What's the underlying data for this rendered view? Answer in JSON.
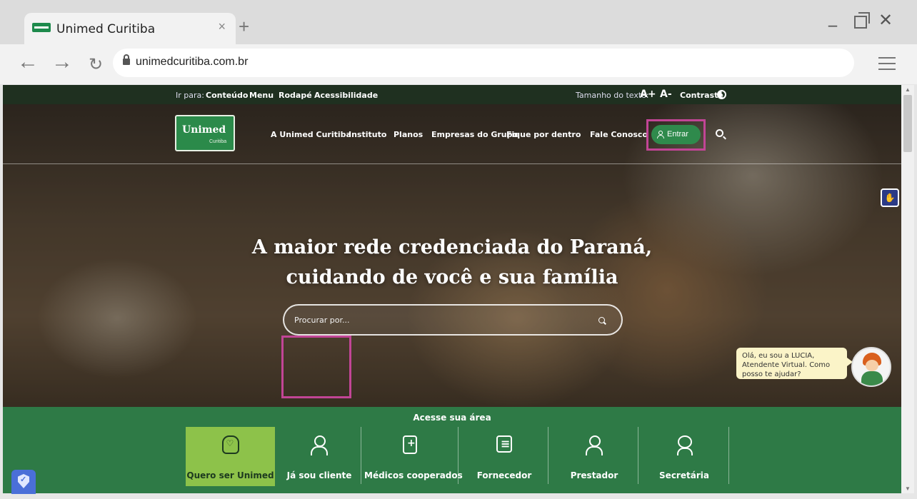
{
  "browser": {
    "tab_title": "Unimed Curitiba",
    "tab_close": "×",
    "new_tab": "+",
    "url": "unimedcuritiba.com.br",
    "minimize": "_",
    "close": "✕"
  },
  "utility_bar": {
    "goto_label": "Ir para:",
    "links": [
      "Conteúdo",
      "Menu",
      "Rodapé",
      "Acessibilidade"
    ],
    "text_size_label": "Tamanho do texto:",
    "increase": "A+",
    "decrease": "A-",
    "contrast": "Contraste"
  },
  "header": {
    "logo_text": "Unimed",
    "logo_sub": "Curitiba",
    "nav": [
      "A Unimed Curitiba",
      "Instituto",
      "Planos",
      "Empresas do Grupo",
      "Fique por dentro",
      "Fale Conosco"
    ],
    "login_label": "Entrar"
  },
  "hero": {
    "headline_line1": "A maior rede credenciada do Paraná,",
    "headline_line2": "cuidando de você e sua família",
    "search_placeholder": "Procurar por..."
  },
  "access": {
    "title": "Acesse sua área",
    "cards": [
      {
        "label": "Quero ser Unimed",
        "icon": "house-heart-icon"
      },
      {
        "label": "Já sou cliente",
        "icon": "person-lock-icon"
      },
      {
        "label": "Médicos cooperados",
        "icon": "doctor-icon"
      },
      {
        "label": "Fornecedor",
        "icon": "document-icon"
      },
      {
        "label": "Prestador",
        "icon": "people-icon"
      },
      {
        "label": "Secretária",
        "icon": "headset-icon"
      }
    ]
  },
  "chat": {
    "message": "Olá, eu sou a LUCIA, Atendente Virtual. Como posso te ajudar?"
  },
  "colors": {
    "brand_green": "#2e7a46",
    "active_card": "#8dc24a",
    "highlight": "#c24596"
  }
}
